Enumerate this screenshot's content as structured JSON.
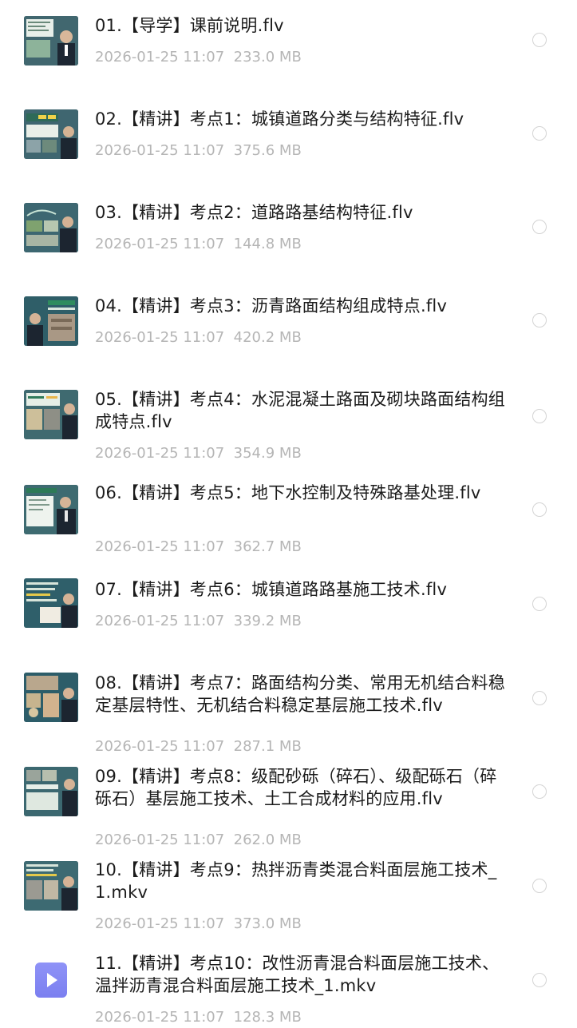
{
  "files": [
    {
      "name": "01.【导学】课前说明.flv",
      "date": "2026-01-25 11:07",
      "size": "233.0 MB",
      "thumbnail": "video-frame",
      "accent": "#2f7b5a"
    },
    {
      "name": "02.【精讲】考点1：城镇道路分类与结构特征.flv",
      "date": "2026-01-25 11:07",
      "size": "375.6 MB",
      "thumbnail": "video-frame",
      "accent": "#2e6e5d"
    },
    {
      "name": "03.【精讲】考点2：道路路基结构特征.flv",
      "date": "2026-01-25 11:07",
      "size": "144.8 MB",
      "thumbnail": "video-frame",
      "accent": "#2d6a63"
    },
    {
      "name": "04.【精讲】考点3：沥青路面结构组成特点.flv",
      "date": "2026-01-25 11:07",
      "size": "420.2 MB",
      "thumbnail": "video-frame",
      "accent": "#2a5a67"
    },
    {
      "name": "05.【精讲】考点4：水泥混凝土路面及砌块路面结构组成特点.flv",
      "date": "2026-01-25 11:07",
      "size": "354.9 MB",
      "thumbnail": "video-frame",
      "accent": "#2d6b63"
    },
    {
      "name": "06.【精讲】考点5：地下水控制及特殊路基处理.flv",
      "date": "2026-01-25 11:07",
      "size": "362.7 MB",
      "thumbnail": "video-frame",
      "accent": "#2b6a66"
    },
    {
      "name": "07.【精讲】考点6：城镇道路路基施工技术.flv",
      "date": "2026-01-25 11:07",
      "size": "339.2 MB",
      "thumbnail": "video-frame",
      "accent": "#2a5f69"
    },
    {
      "name": "08.【精讲】考点7：路面结构分类、常用无机结合料稳定基层特性、无机结合料稳定基层施工技术.flv",
      "date": "2026-01-25 11:07",
      "size": "287.1 MB",
      "thumbnail": "video-frame",
      "accent": "#2b5d68"
    },
    {
      "name": "09.【精讲】考点8：级配砂砾（碎石）、级配砾石（碎砾石）基层施工技术、土工合成材料的应用.flv",
      "date": "2026-01-25 11:07",
      "size": "262.0 MB",
      "thumbnail": "video-frame",
      "accent": "#2c6264"
    },
    {
      "name": "10.【精讲】考点9：热拌沥青类混合料面层施工技术_1.mkv",
      "date": "2026-01-25 11:07",
      "size": "373.0 MB",
      "thumbnail": "video-frame",
      "accent": "#2d6865"
    },
    {
      "name": "11.【精讲】考点10：改性沥青混合料面层施工技术、温拌沥青混合料面层施工技术_1.mkv",
      "date": "2026-01-25 11:07",
      "size": "128.3 MB",
      "thumbnail": "video-file-icon",
      "accent": "#7f83f2"
    }
  ]
}
